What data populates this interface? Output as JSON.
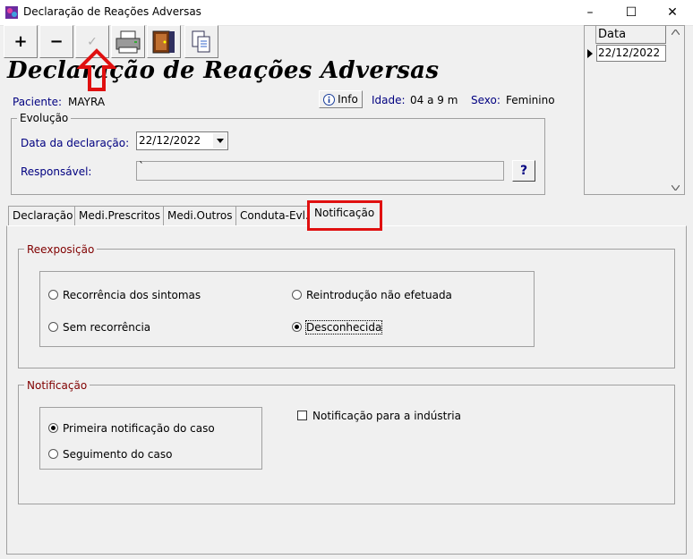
{
  "window": {
    "title": "Declaração de Reações Adversas",
    "minimize": "–",
    "maximize": "☐",
    "close": "✕"
  },
  "toolbar": {
    "add": "+",
    "remove": "−",
    "edit": "✓"
  },
  "header": {
    "title": "Declaração de Reações Adversas",
    "patient_label": "Paciente:",
    "patient_name": "MAYRA",
    "info_button": "Info",
    "age_label": "Idade:",
    "age_value": "04 a 9 m",
    "sex_label": "Sexo:",
    "sex_value": "Feminino"
  },
  "evolucao": {
    "title": "Evolução",
    "date_label": "Data da declaração:",
    "date_value": "22/12/2022",
    "resp_label": "Responsável:",
    "resp_value": "`",
    "help_button": "?"
  },
  "grid": {
    "header": "Data",
    "rows": [
      "22/12/2022"
    ]
  },
  "tabs": [
    "Declaração",
    "Medi.Prescritos",
    "Medi.Outros",
    "Conduta-Evl.",
    "Notificação"
  ],
  "active_tab": "Notificação",
  "reexposicao": {
    "title": "Reexposição",
    "options": [
      {
        "label": "Recorrência dos sintomas",
        "checked": false
      },
      {
        "label": "Reintrodução não efetuada",
        "checked": false
      },
      {
        "label": "Sem recorrência",
        "checked": false
      },
      {
        "label": "Desconhecida",
        "checked": true
      }
    ]
  },
  "notificacao": {
    "title": "Notificação",
    "options": [
      {
        "label": "Primeira notificação do caso",
        "checked": true
      },
      {
        "label": "Seguimento do caso",
        "checked": false
      }
    ],
    "industry_checkbox": {
      "label": "Notificação para a indústria",
      "checked": false
    }
  },
  "colors": {
    "highlight": "#e01010",
    "label_blue": "#000080",
    "group_title_red": "#800000"
  }
}
